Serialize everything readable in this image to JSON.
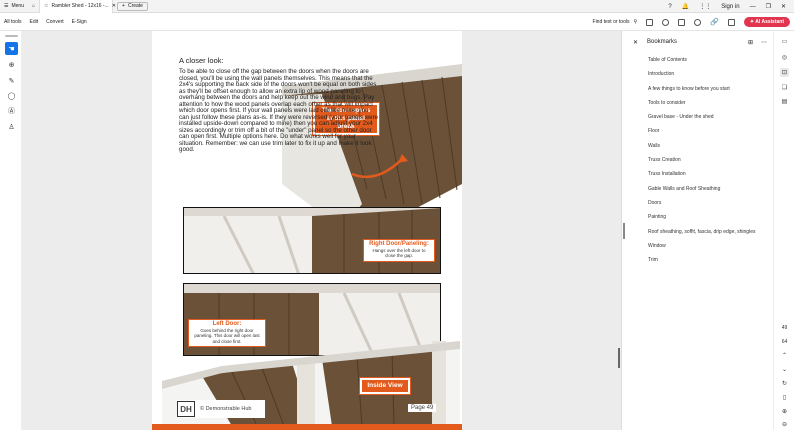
{
  "titlebar": {
    "menu_label": "Menu",
    "tab_title": "Rambler Shed - 12x16 -...",
    "create_label": "Create",
    "sign_in": "Sign in"
  },
  "menubar": {
    "items": [
      "All tools",
      "Edit",
      "Convert",
      "E-Sign"
    ],
    "find_label": "Find text or tools",
    "ai_label": "AI Assistant"
  },
  "page": {
    "heading": "A closer look:",
    "body": "To be able to close off the gap between the doors when the doors are closed, you'll be using the wall panels themselves. This means that the 2x4's supporting the back side of the doors won't be equal on both sides as they'll be offset enough to allow an extra lip of wood paneling to overhang between the doors and help keep out the wind and bugs. Pay attention to how the wood panels overlap each other as that will impact which door opens first. If your wall panels were laid out like mine, you can just follow these plans as-is. If they were reversed (your panels were installed upside-down compared to mine) then you can adjust your 2x4 sizes accordingly or trim off a bit of the \"under\" panel so the other door can open first. Multiple options here. Do what works well for your situation. Remember: we can use trim later to fix it up and make it look good.",
    "callout_door_opens": "The door opens at this panel break",
    "callout_right_title": "Right Door/Paneling:",
    "callout_right_text": "Hangs over the left door to close the gap.",
    "callout_left_title": "Left Door:",
    "callout_left_text": "Goes behind the right door paneling. This door will open last and close first.",
    "callout_inside": "Inside View",
    "logo_letters": "DH",
    "footer_brand": "© Demonstrable Hub",
    "page_number": "Page 49"
  },
  "bookmarks": {
    "title": "Bookmarks",
    "items": [
      "Table of Contents",
      "Introduction",
      "A few things to know before you start",
      "Tools to consider",
      "Gravel base - Under the shed",
      "Floor",
      "Walls",
      "Truss Creation",
      "Truss Installation",
      "Gable Walls and Roof Sheathing",
      "Doors",
      "Painting",
      "Roof sheathing, soffit, fascia, drip edge, shingles",
      "Window",
      "Trim"
    ]
  },
  "rightrail": {
    "page_current": "49",
    "page_total": "64"
  },
  "colors": {
    "accent": "#1473e6",
    "ai": "#e0344f",
    "callout": "#e35b1c",
    "wood": "#6b5138"
  }
}
